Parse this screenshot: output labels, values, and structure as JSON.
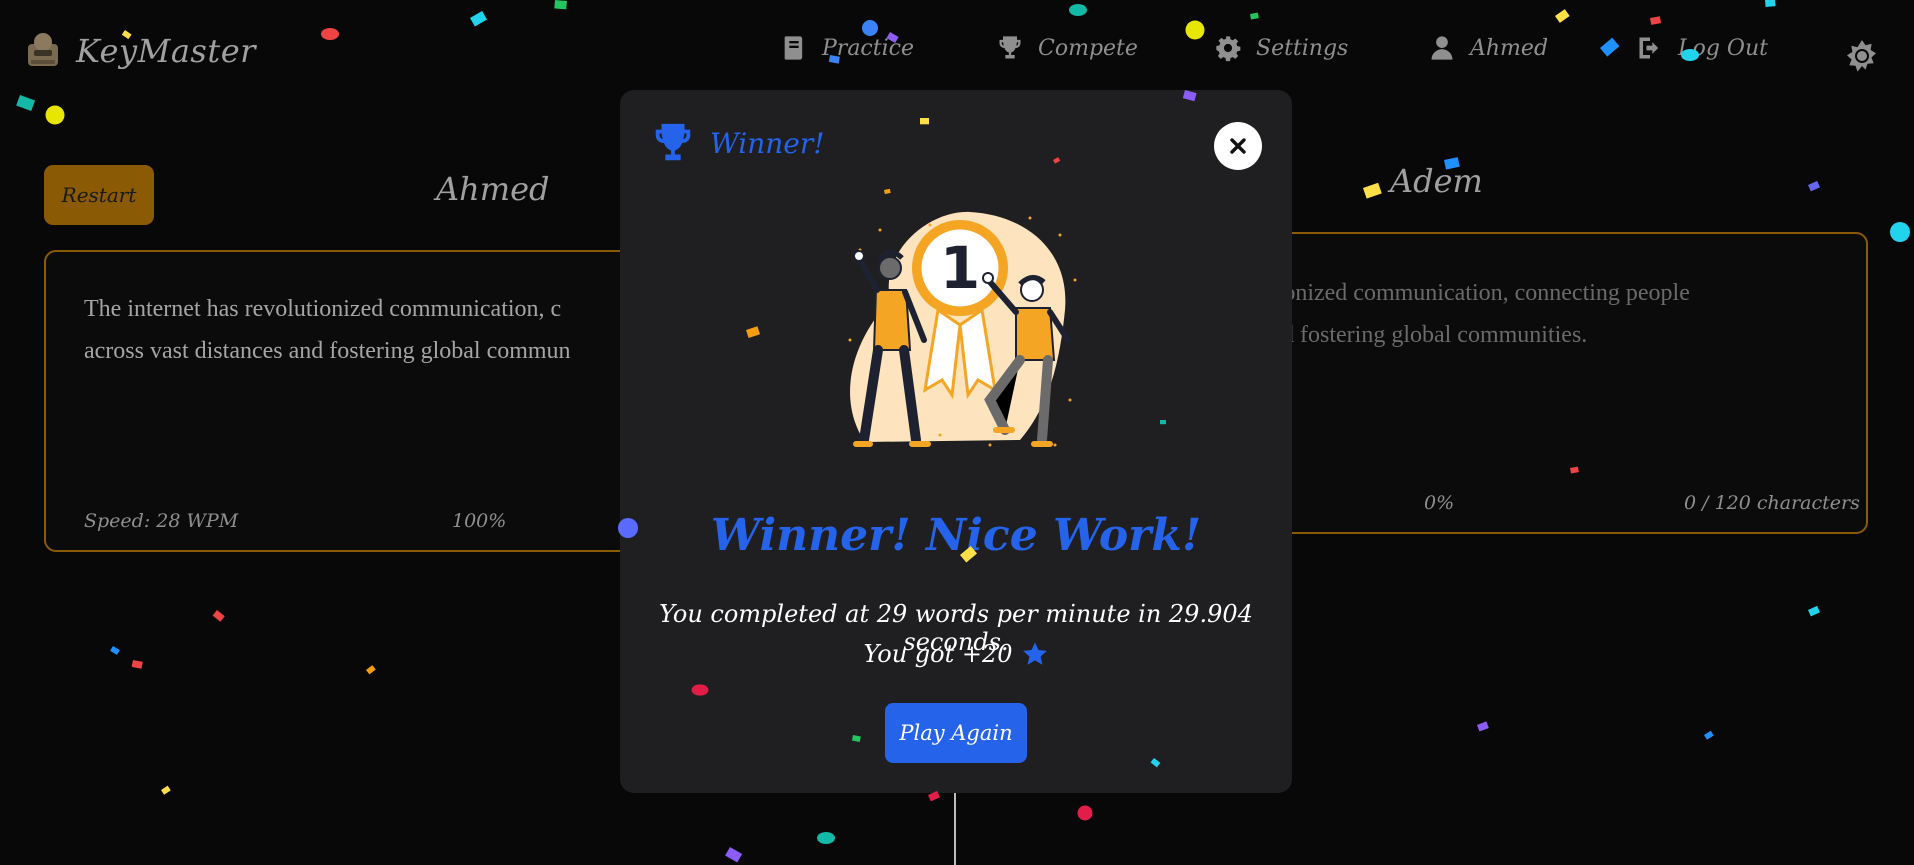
{
  "nav": {
    "brand": "KeyMaster",
    "practice": "Practice",
    "compete": "Compete",
    "settings": "Settings",
    "user": "Ahmed",
    "logout": "Log Out",
    "icons": [
      "book-icon",
      "trophy-icon",
      "gear-icon",
      "user-icon",
      "logout-icon",
      "theme-toggle-icon"
    ]
  },
  "left": {
    "restart_label": "Restart",
    "player": "Ahmed",
    "text_line1": "The internet has revolutionized communication, c",
    "text_line2": "across vast distances and fostering global commun",
    "speed": "Speed: 28 WPM",
    "progress": "100%"
  },
  "right": {
    "player": "Adem",
    "text_line1": "tionized communication, connecting people",
    "text_line2": "nd fostering global communities.",
    "progress": "0%",
    "chars": "0 / 120 characters"
  },
  "modal": {
    "title": "Winner!",
    "badge_number": "1",
    "heading": "Winner! Nice Work!",
    "line1": "You completed at 29 words per minute in 29.904 seconds.",
    "line2": "You got +20",
    "play_again": "Play Again"
  },
  "colors": {
    "accent": "#2563eb",
    "gold": "#8a5a05",
    "background": "#080808",
    "modal": "#1f1f21"
  }
}
